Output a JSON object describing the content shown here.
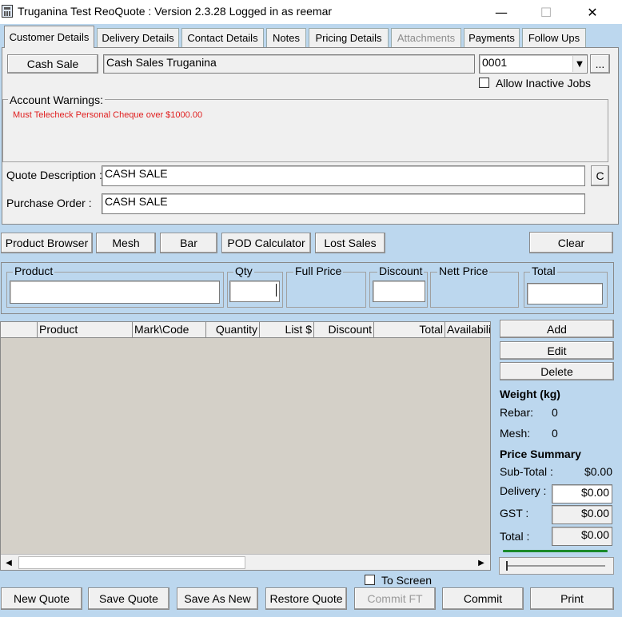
{
  "window": {
    "title": "Truganina Test ReoQuote : Version 2.3.28 Logged in as reemar",
    "minimize": "—",
    "maximize": "☐",
    "close": "✕"
  },
  "tabs": [
    {
      "label": "Customer Details",
      "active": true
    },
    {
      "label": "Delivery Details"
    },
    {
      "label": "Contact Details"
    },
    {
      "label": "Notes"
    },
    {
      "label": "Pricing Details"
    },
    {
      "label": "Attachments",
      "disabled": true
    },
    {
      "label": "Payments"
    },
    {
      "label": "Follow Ups"
    }
  ],
  "customer": {
    "cash_sale_button": "Cash Sale",
    "customer_name": "Cash Sales Truganina",
    "job_number": "0001",
    "browse_button": "...",
    "allow_inactive_jobs": "Allow Inactive Jobs",
    "account_warnings_label": "Account Warnings:",
    "account_warning_text": "Must Telecheck Personal Cheque over $1000.00",
    "quote_description_label": "Quote Description :",
    "quote_description": "CASH SALE",
    "c_button": "C",
    "purchase_order_label": "Purchase Order :",
    "purchase_order": "CASH SALE"
  },
  "toolbar": {
    "product_browser": "Product Browser",
    "mesh": "Mesh",
    "bar": "Bar",
    "pod_calculator": "POD Calculator",
    "lost_sales": "Lost Sales",
    "clear": "Clear"
  },
  "entry": {
    "product": "Product",
    "qty": "Qty",
    "full_price": "Full Price",
    "discount": "Discount",
    "nett_price": "Nett Price",
    "total": "Total"
  },
  "grid": {
    "columns": [
      "Product",
      "Mark\\Code",
      "Quantity",
      "List $",
      "Discount",
      "Total",
      "Availabilit"
    ]
  },
  "side": {
    "add": "Add",
    "edit": "Edit",
    "delete": "Delete",
    "weight_title": "Weight (kg)",
    "rebar_label": "Rebar:",
    "rebar_value": "0",
    "mesh_label": "Mesh:",
    "mesh_value": "0",
    "price_summary_title": "Price Summary",
    "subtotal_label": "Sub-Total :",
    "subtotal_value": "$0.00",
    "delivery_label": "Delivery :",
    "delivery_value": "$0.00",
    "gst_label": "GST :",
    "gst_value": "$0.00",
    "total_label": "Total :",
    "total_value": "$0.00"
  },
  "footer": {
    "to_screen": "To Screen",
    "new_quote": "New Quote",
    "save_quote": "Save Quote",
    "save_as_new": "Save As New",
    "restore_quote": "Restore Quote",
    "commit_ft": "Commit FT",
    "commit": "Commit",
    "print": "Print"
  },
  "colors": {
    "background": "#bcd7ee",
    "warning_text": "#e02020",
    "progress_green": "#1a8a2a"
  }
}
